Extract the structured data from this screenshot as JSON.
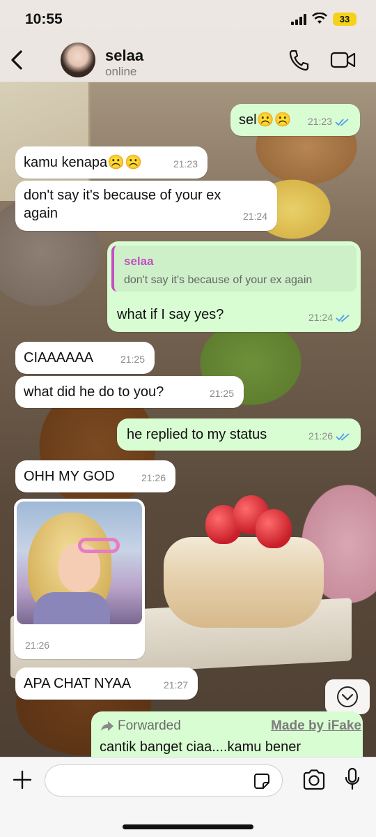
{
  "status_bar": {
    "time": "10:55",
    "battery": "33"
  },
  "header": {
    "contact_name": "selaa",
    "contact_status": "online"
  },
  "messages": [
    {
      "dir": "out",
      "text": "sel☹️☹️",
      "time": "21:23",
      "read": true
    },
    {
      "dir": "in",
      "text": "kamu kenapa☹️☹️",
      "time": "21:23"
    },
    {
      "dir": "in",
      "text_line1": "don't say it's because of your ex",
      "text_line2": "again",
      "time": "21:24"
    },
    {
      "dir": "out",
      "quote_name": "selaa",
      "quote_text": "don't say it's because of your ex again",
      "text": "what if I say yes?",
      "time": "21:24",
      "read": true
    },
    {
      "dir": "in",
      "text": "CIAAAAAA",
      "time": "21:25"
    },
    {
      "dir": "in",
      "text": "what did he do to you?",
      "time": "21:25"
    },
    {
      "dir": "out",
      "text": "he replied to my status",
      "time": "21:26",
      "read": true
    },
    {
      "dir": "in",
      "text": "OHH MY GOD",
      "time": "21:26"
    },
    {
      "dir": "in",
      "type": "image",
      "time": "21:26"
    },
    {
      "dir": "in",
      "text": "APA CHAT NYAA",
      "time": "21:27"
    },
    {
      "dir": "out",
      "forwarded_label": "Forwarded",
      "text": "cantik banget ciaa....kamu bener"
    }
  ],
  "watermark": "Made by iFake",
  "input": {
    "placeholder": ""
  },
  "icons": {
    "back": "chevron-left-icon",
    "call": "phone-icon",
    "video": "video-camera-icon",
    "scroll": "chevron-down-circle-icon",
    "plus": "plus-icon",
    "sticker": "sticker-icon",
    "camera": "camera-icon",
    "mic": "microphone-icon"
  },
  "colors": {
    "outgoing": "#d9fdd3",
    "incoming": "#ffffff",
    "read_ticks": "#4f9ee8",
    "quote_accent": "#c44ec4"
  }
}
